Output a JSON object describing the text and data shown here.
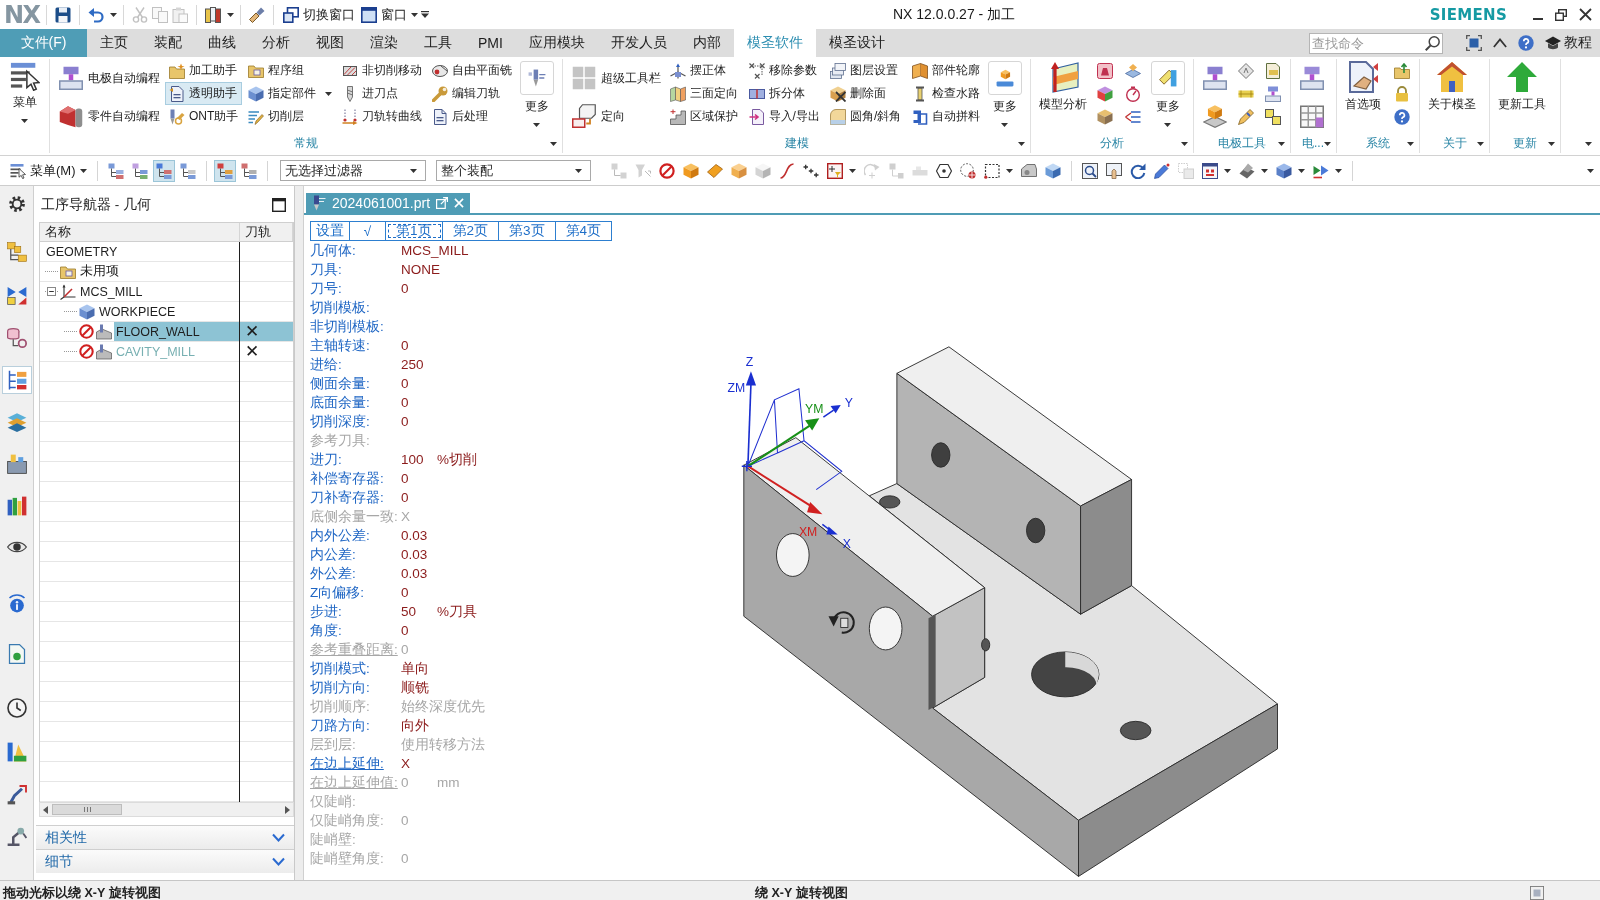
{
  "title_bar": {
    "logo": "NX",
    "quick_access": [
      {
        "kind": "icon",
        "disabled": false
      },
      {
        "kind": "split",
        "disabled": false
      },
      {
        "kind": "icon",
        "disabled": true
      },
      {
        "kind": "icon",
        "disabled": true
      },
      {
        "kind": "icon",
        "disabled": true
      },
      {
        "kind": "split",
        "disabled": false
      },
      {
        "kind": "icon",
        "disabled": false
      }
    ],
    "switch_window": "切换窗口",
    "window_menu": "窗口",
    "title": "NX 12.0.0.27 - 加工",
    "brand": "SIEMENS"
  },
  "menu_bar": {
    "file": "文件(F)",
    "tabs": [
      {
        "label": "主页",
        "selected": false
      },
      {
        "label": "装配",
        "selected": false
      },
      {
        "label": "曲线",
        "selected": false
      },
      {
        "label": "分析",
        "selected": false
      },
      {
        "label": "视图",
        "selected": false
      },
      {
        "label": "渲染",
        "selected": false
      },
      {
        "label": "工具",
        "selected": false
      },
      {
        "label": "PMI",
        "selected": false
      },
      {
        "label": "应用模块",
        "selected": false
      },
      {
        "label": "开发人员",
        "selected": false
      },
      {
        "label": "内部",
        "selected": false
      },
      {
        "label": "模圣软件",
        "selected": true
      },
      {
        "label": "模圣设计",
        "selected": false
      }
    ],
    "search": {
      "placeholder": "查找命令"
    },
    "tutorial": "教程"
  },
  "ribbon": {
    "groups": [
      {
        "columns": [
          [
            {
              "kind": "large-menu",
              "label": "菜单"
            }
          ]
        ]
      },
      {
        "title": "常规",
        "columns": [
          [
            {
              "kind": "medium",
              "label": "电极自动编程"
            },
            {
              "kind": "medium",
              "label": "零件自动编程"
            }
          ],
          [
            {
              "kind": "small",
              "label": "加工助手",
              "on": false
            },
            {
              "kind": "small",
              "label": "透明助手",
              "on": true
            },
            {
              "kind": "small",
              "label": "ONT助手",
              "on": false
            }
          ],
          [
            {
              "kind": "small",
              "label": "程序组"
            },
            {
              "kind": "small-menu",
              "label": "指定部件"
            },
            {
              "kind": "small",
              "label": "切削层"
            }
          ],
          [
            {
              "kind": "small",
              "label": "非切削移动"
            },
            {
              "kind": "small",
              "label": "进刀点"
            },
            {
              "kind": "small",
              "label": "刀轨转曲线"
            }
          ],
          [
            {
              "kind": "small",
              "label": "自由平面铣"
            },
            {
              "kind": "small",
              "label": "编辑刀轨"
            },
            {
              "kind": "small",
              "label": "后处理"
            }
          ],
          [
            {
              "kind": "more",
              "label": "更多"
            }
          ]
        ]
      },
      {
        "title": "建模",
        "columns": [
          [
            {
              "kind": "medium",
              "label": "超级工具栏"
            },
            {
              "kind": "medium",
              "label": "定向"
            }
          ],
          [
            {
              "kind": "small",
              "label": "摆正体"
            },
            {
              "kind": "small",
              "label": "三面定向"
            },
            {
              "kind": "small",
              "label": "区域保护"
            }
          ],
          [
            {
              "kind": "small",
              "label": "移除参数"
            },
            {
              "kind": "small",
              "label": "拆分体"
            },
            {
              "kind": "small",
              "label": "导入/导出"
            }
          ],
          [
            {
              "kind": "small",
              "label": "图层设置"
            },
            {
              "kind": "small",
              "label": "删除面"
            },
            {
              "kind": "small",
              "label": "圆角/斜角"
            }
          ],
          [
            {
              "kind": "small",
              "label": "部件轮廓"
            },
            {
              "kind": "small",
              "label": "检查水路"
            },
            {
              "kind": "small",
              "label": "自动拼料"
            }
          ],
          [
            {
              "kind": "more",
              "label": "更多"
            }
          ]
        ]
      },
      {
        "title": "分析",
        "columns": [
          [
            {
              "kind": "large",
              "label": "模型分析"
            }
          ],
          [
            {
              "kind": "icon"
            },
            {
              "kind": "icon"
            },
            {
              "kind": "icon"
            }
          ],
          [
            {
              "kind": "icon"
            },
            {
              "kind": "icon"
            },
            {
              "kind": "icon"
            }
          ],
          [
            {
              "kind": "more",
              "label": "更多"
            }
          ]
        ]
      },
      {
        "title": "电极工具",
        "columns": [
          [
            {
              "kind": "medium-icon"
            },
            {
              "kind": "medium-icon"
            }
          ],
          [
            {
              "kind": "icon"
            },
            {
              "kind": "icon"
            },
            {
              "kind": "icon"
            }
          ],
          [
            {
              "kind": "icon"
            },
            {
              "kind": "icon"
            },
            {
              "kind": "icon"
            }
          ]
        ]
      },
      {
        "title": "电...",
        "columns": [
          [
            {
              "kind": "medium-icon"
            },
            {
              "kind": "medium-icon"
            }
          ]
        ]
      },
      {
        "title": "系统",
        "columns": [
          [
            {
              "kind": "large",
              "label": "首选项"
            }
          ],
          [
            {
              "kind": "icon"
            },
            {
              "kind": "icon"
            },
            {
              "kind": "icon"
            }
          ]
        ]
      },
      {
        "title": "关于",
        "columns": [
          [
            {
              "kind": "large",
              "label": "关于模圣"
            }
          ]
        ]
      },
      {
        "title": "更新",
        "columns": [
          [
            {
              "kind": "large",
              "label": "更新工具"
            }
          ]
        ]
      }
    ]
  },
  "toolbar": {
    "menu": "菜单(M)",
    "sections": [
      {
        "kind": "icons",
        "items": [
          {
            "kind": "icon",
            "pressed": false,
            "disabled": false
          },
          {
            "kind": "icon",
            "pressed": false,
            "disabled": false
          },
          {
            "kind": "icon",
            "pressed": true,
            "disabled": false
          },
          {
            "kind": "icon",
            "pressed": false,
            "disabled": false
          }
        ]
      },
      {
        "kind": "icons",
        "items": [
          {
            "kind": "icon",
            "pressed": true,
            "disabled": false
          },
          {
            "kind": "icon",
            "pressed": false,
            "disabled": false
          }
        ]
      },
      {
        "kind": "filters",
        "items": [
          {
            "value": "无选择过滤器"
          },
          {
            "value": "整个装配"
          }
        ]
      },
      {
        "kind": "icons",
        "items": [
          {
            "kind": "icon",
            "pressed": false,
            "disabled": true
          },
          {
            "kind": "icon",
            "pressed": false,
            "disabled": true
          },
          {
            "kind": "icon",
            "pressed": false,
            "disabled": false
          },
          {
            "kind": "icon",
            "pressed": false,
            "disabled": false
          },
          {
            "kind": "icon",
            "pressed": false,
            "disabled": false
          },
          {
            "kind": "icon",
            "pressed": false,
            "disabled": false
          },
          {
            "kind": "icon",
            "pressed": false,
            "disabled": false
          },
          {
            "kind": "icon",
            "pressed": false,
            "disabled": false
          },
          {
            "kind": "icon",
            "pressed": false,
            "disabled": false
          },
          {
            "kind": "split",
            "pressed": false,
            "disabled": false
          },
          {
            "kind": "icon",
            "pressed": false,
            "disabled": true
          },
          {
            "kind": "icon",
            "pressed": false,
            "disabled": true
          },
          {
            "kind": "icon",
            "pressed": false,
            "disabled": true
          },
          {
            "kind": "icon",
            "pressed": false,
            "disabled": false
          },
          {
            "kind": "icon",
            "pressed": false,
            "disabled": false
          },
          {
            "kind": "split",
            "pressed": false,
            "disabled": false
          },
          {
            "kind": "icon",
            "pressed": false,
            "disabled": false
          },
          {
            "kind": "icon",
            "pressed": false,
            "disabled": false
          }
        ]
      },
      {
        "kind": "icons",
        "items": [
          {
            "kind": "icon",
            "pressed": false,
            "disabled": false
          },
          {
            "kind": "icon",
            "pressed": false,
            "disabled": false
          },
          {
            "kind": "icon",
            "pressed": false,
            "disabled": false
          },
          {
            "kind": "icon",
            "pressed": false,
            "disabled": false
          },
          {
            "kind": "icon",
            "pressed": false,
            "disabled": true
          },
          {
            "kind": "split",
            "pressed": false,
            "disabled": false
          },
          {
            "kind": "split",
            "pressed": false,
            "disabled": false
          },
          {
            "kind": "split",
            "pressed": false,
            "disabled": false
          },
          {
            "kind": "split",
            "pressed": false,
            "disabled": false
          }
        ]
      }
    ]
  },
  "resource_bar": {
    "items": [
      {
        "selected": false
      },
      {
        "selected": false
      },
      {
        "selected": false
      },
      {
        "selected": true
      },
      {
        "selected": false
      },
      {
        "selected": false
      },
      {
        "selected": false
      },
      {
        "selected": false
      },
      {
        "selected": false
      },
      {
        "selected": false
      },
      {
        "selected": false
      },
      {
        "selected": false
      },
      {
        "selected": false
      },
      {
        "selected": false
      }
    ]
  },
  "navigator": {
    "title": "工序导航器 - 几何",
    "columns": [
      "名称",
      "刀轨"
    ],
    "tree": [
      {
        "name": "GEOMETRY",
        "selected": false,
        "children": [
          {
            "name": "未用项",
            "kind": "folder",
            "selected": false,
            "expanded": false
          },
          {
            "name": "MCS_MILL",
            "kind": "csys",
            "selected": false,
            "expanded": true,
            "children": [
              {
                "name": "WORKPIECE",
                "kind": "workpiece",
                "selected": false,
                "dimmed": false
              },
              {
                "name": "FLOOR_WALL",
                "kind": "operation",
                "selected": true,
                "dimmed": false,
                "toolpath": "✕"
              },
              {
                "name": "CAVITY_MILL",
                "kind": "operation",
                "selected": false,
                "dimmed": true,
                "toolpath": "✕"
              }
            ]
          }
        ]
      }
    ],
    "sections": [
      {
        "label": "相关性",
        "expanded": false
      },
      {
        "label": "细节",
        "expanded": false
      }
    ]
  },
  "document_tab": {
    "label": "2024061001.prt"
  },
  "info_panel": {
    "tabs": [
      {
        "label": "设置",
        "selected": false
      },
      {
        "label": "√",
        "selected": false
      },
      {
        "label": "第1页",
        "selected": true
      },
      {
        "label": "第2页",
        "selected": false
      },
      {
        "label": "第3页",
        "selected": false
      },
      {
        "label": "第4页",
        "selected": false
      }
    ],
    "rows": [
      {
        "label": "几何体:",
        "value": "MCS_MILL",
        "disabled": false,
        "underlined": false
      },
      {
        "label": "刀具:",
        "value": "NONE",
        "disabled": false,
        "underlined": false
      },
      {
        "label": "刀号:",
        "value": "0",
        "disabled": false,
        "underlined": false
      },
      {
        "label": "切削模板:",
        "disabled": false,
        "underlined": false
      },
      {
        "label": "非切削模板:",
        "disabled": false,
        "underlined": false
      },
      {
        "label": "主轴转速:",
        "value": "0",
        "disabled": false,
        "underlined": false
      },
      {
        "label": "进给:",
        "value": "250",
        "disabled": false,
        "underlined": false
      },
      {
        "label": "侧面余量:",
        "value": "0",
        "disabled": false,
        "underlined": false
      },
      {
        "label": "底面余量:",
        "value": "0",
        "disabled": false,
        "underlined": false
      },
      {
        "label": "切削深度:",
        "value": "0",
        "disabled": false,
        "underlined": false
      },
      {
        "label": "参考刀具:",
        "disabled": true,
        "underlined": false
      },
      {
        "label": "进刀:",
        "value": "100",
        "unit": "%切削",
        "disabled": false,
        "underlined": false
      },
      {
        "label": "补偿寄存器:",
        "value": "0",
        "disabled": false,
        "underlined": false
      },
      {
        "label": "刀补寄存器:",
        "value": "0",
        "disabled": false,
        "underlined": false
      },
      {
        "label": "底侧余量一致:",
        "value": "X",
        "disabled": true,
        "underlined": false
      },
      {
        "label": "内外公差:",
        "value": "0.03",
        "disabled": false,
        "underlined": false
      },
      {
        "label": "内公差:",
        "value": "0.03",
        "disabled": false,
        "underlined": false
      },
      {
        "label": "外公差:",
        "value": "0.03",
        "disabled": false,
        "underlined": false
      },
      {
        "label": "Z向偏移:",
        "value": "0",
        "disabled": false,
        "underlined": false
      },
      {
        "label": "步进:",
        "value": "50",
        "unit": "%刀具",
        "disabled": false,
        "underlined": false
      },
      {
        "label": "角度:",
        "value": "0",
        "disabled": false,
        "underlined": false
      },
      {
        "label": "参考重叠距离:",
        "value": "0",
        "disabled": true,
        "underlined": true
      },
      {
        "label": "切削模式:",
        "value": "单向",
        "disabled": false,
        "underlined": false
      },
      {
        "label": "切削方向:",
        "value": "顺铣",
        "disabled": false,
        "underlined": false
      },
      {
        "label": "切削顺序:",
        "value": "始终深度优先",
        "disabled": true,
        "underlined": false
      },
      {
        "label": "刀路方向:",
        "value": "向外",
        "disabled": false,
        "underlined": false
      },
      {
        "label": "层到层:",
        "value": "使用转移方法",
        "disabled": true,
        "underlined": false
      },
      {
        "label": "在边上延伸:",
        "value": "X",
        "disabled": false,
        "underlined": true
      },
      {
        "label": "在边上延伸值:",
        "value": "0",
        "unit": "mm",
        "disabled": true,
        "underlined": true
      },
      {
        "label": "仅陡峭:",
        "disabled": true,
        "underlined": false
      },
      {
        "label": "仅陡峭角度:",
        "value": "0",
        "disabled": true,
        "underlined": false
      },
      {
        "label": "陡峭壁:",
        "disabled": true,
        "underlined": false
      },
      {
        "label": "陡峭壁角度:",
        "value": "0",
        "disabled": true,
        "underlined": false
      }
    ]
  },
  "csys": {
    "labels": [
      "Z",
      "ZM",
      "YM",
      "Y",
      "XM",
      "X"
    ]
  },
  "status_bar": {
    "prompt": "拖动光标以绕 X-Y 旋转视图",
    "status": "绕 X-Y 旋转视图"
  }
}
